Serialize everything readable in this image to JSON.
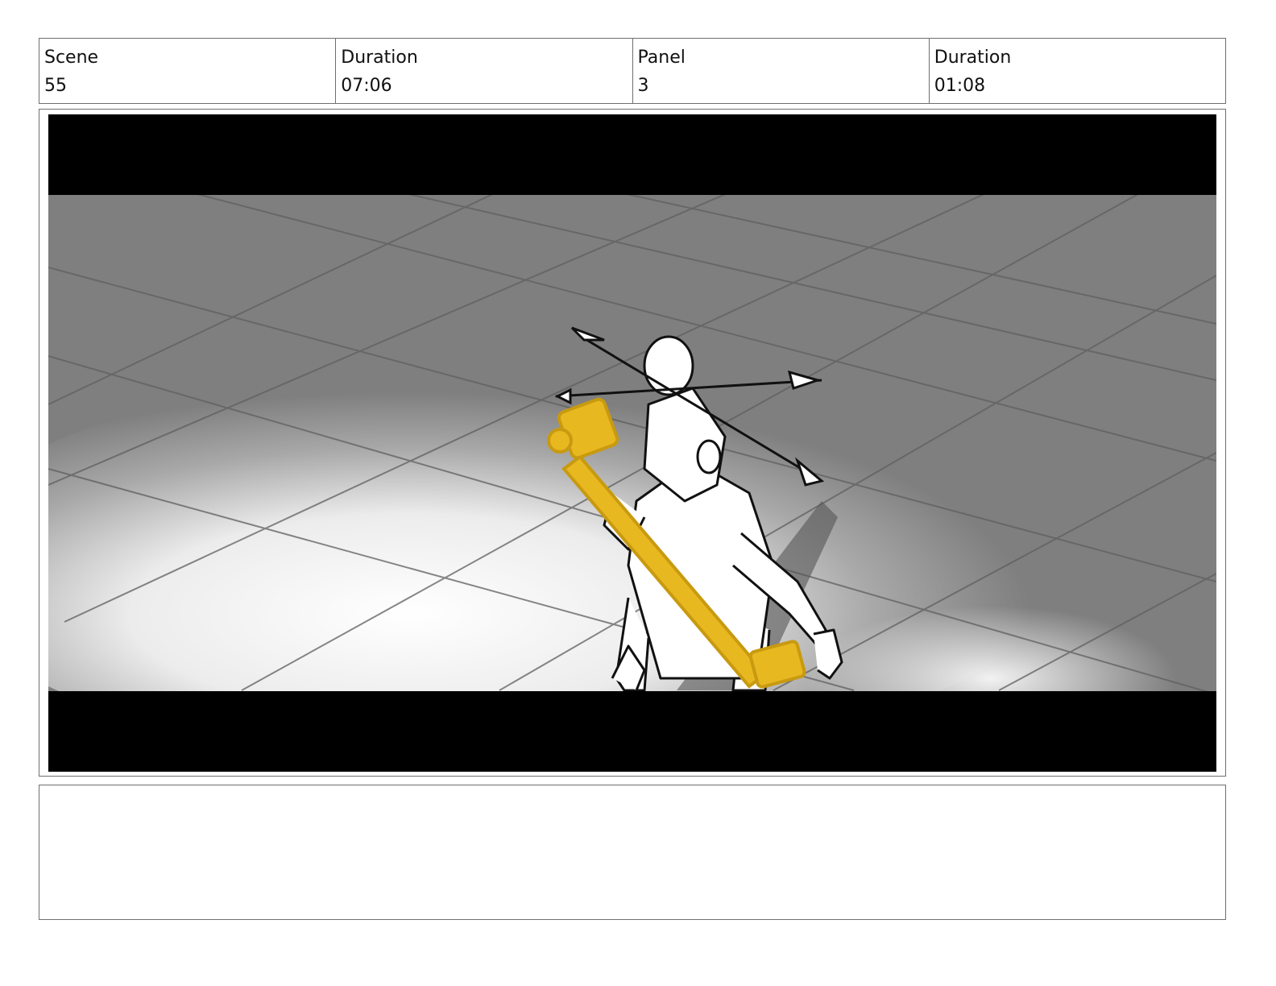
{
  "header": {
    "scene_label": "Scene",
    "scene_value": "55",
    "scene_duration_label": "Duration",
    "scene_duration_value": "07:06",
    "panel_label": "Panel",
    "panel_value": "3",
    "panel_duration_label": "Duration",
    "panel_duration_value": "01:08"
  },
  "panel": {
    "description": "",
    "colors": {
      "letterbox": "#000000",
      "floor_shadow": "#7f7f7f",
      "spotlight": "#f2f2f2",
      "highlight_yellow": "#e8b820",
      "line_ink": "#111111"
    }
  },
  "notes": {
    "text": ""
  }
}
